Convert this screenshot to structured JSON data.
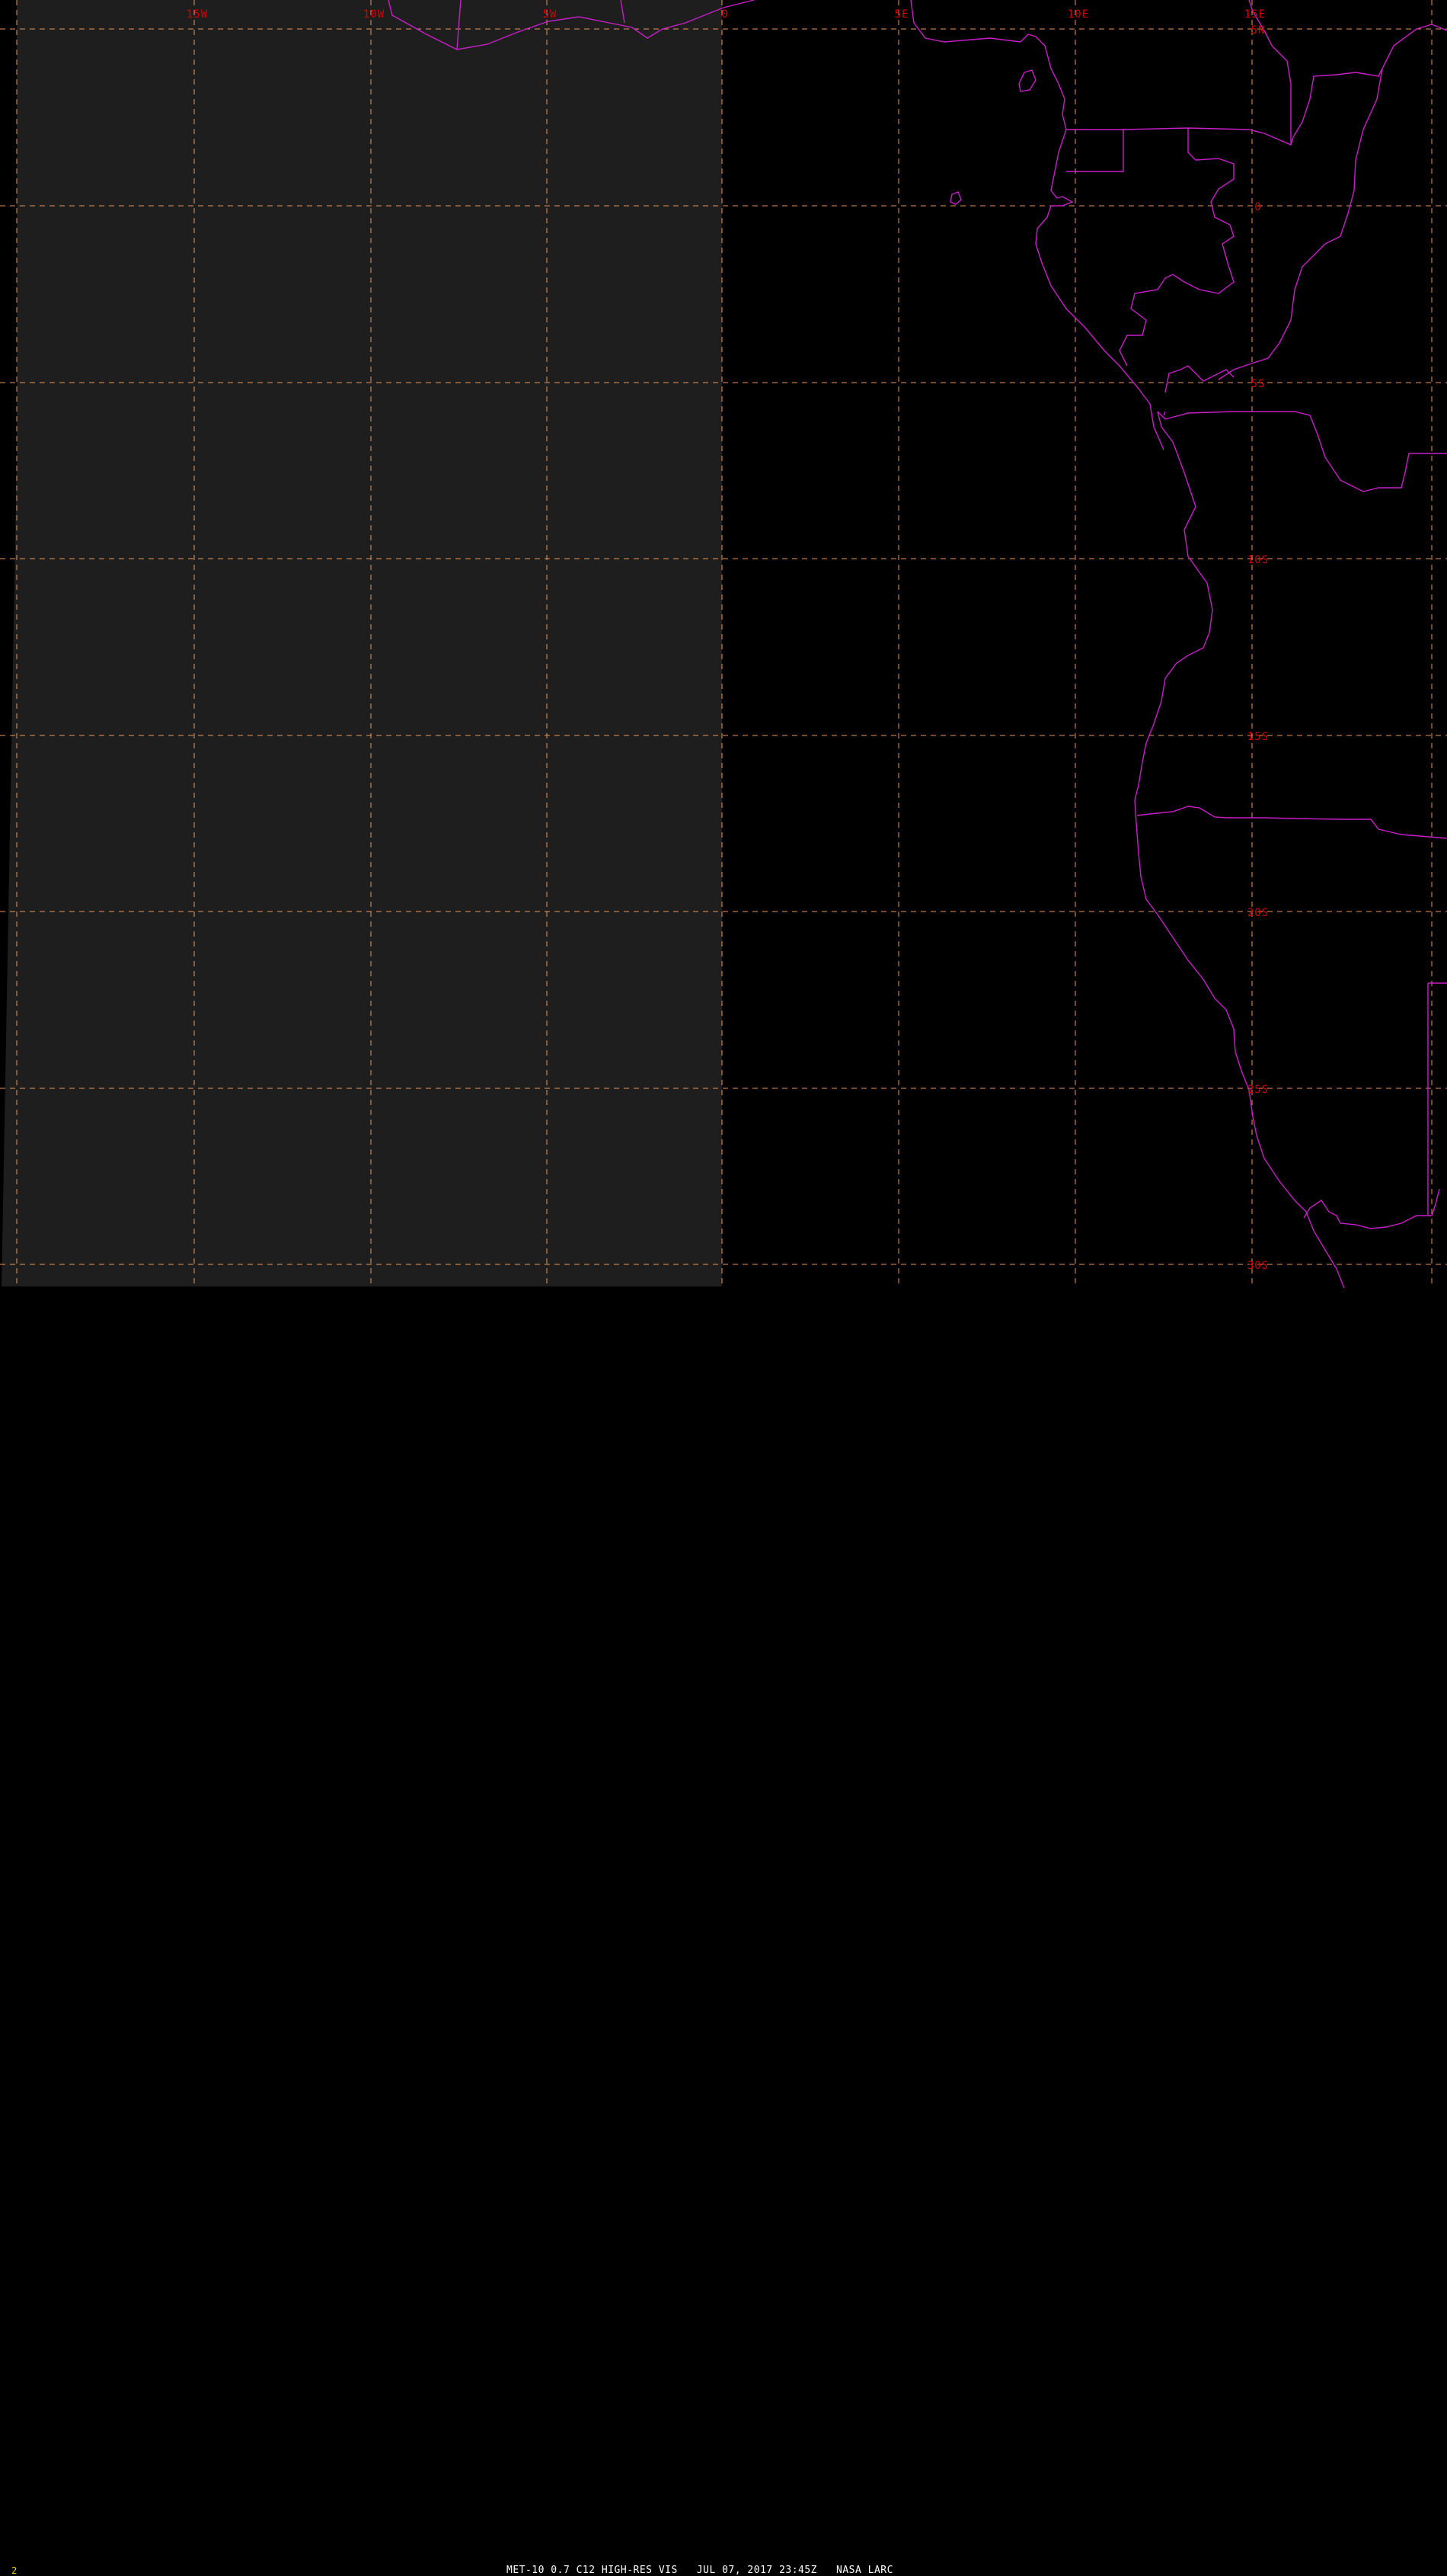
{
  "colors": {
    "background": "#000000",
    "shaded_panel": "#1e1e1e",
    "grid": "#e8985a",
    "grid_label": "#d40000",
    "coastline": "#c81ec8",
    "caption": "#ffffff",
    "frame_number": "#e6d200"
  },
  "map": {
    "lon_labels": [
      "15W",
      "10W",
      "5W",
      "0",
      "5E",
      "10E",
      "15E"
    ],
    "lat_labels": [
      "5N",
      "0",
      "5S",
      "10S",
      "15S",
      "20S",
      "25S",
      "30S"
    ],
    "grid_style": "dashed",
    "shaded_region": "west of 0 (dim imagery field)"
  },
  "footer": {
    "frame_number": "2",
    "caption": "MET-10 0.7 C12 HIGH-RES VIS   JUL 07, 2017 23:45Z   NASA LARC"
  }
}
